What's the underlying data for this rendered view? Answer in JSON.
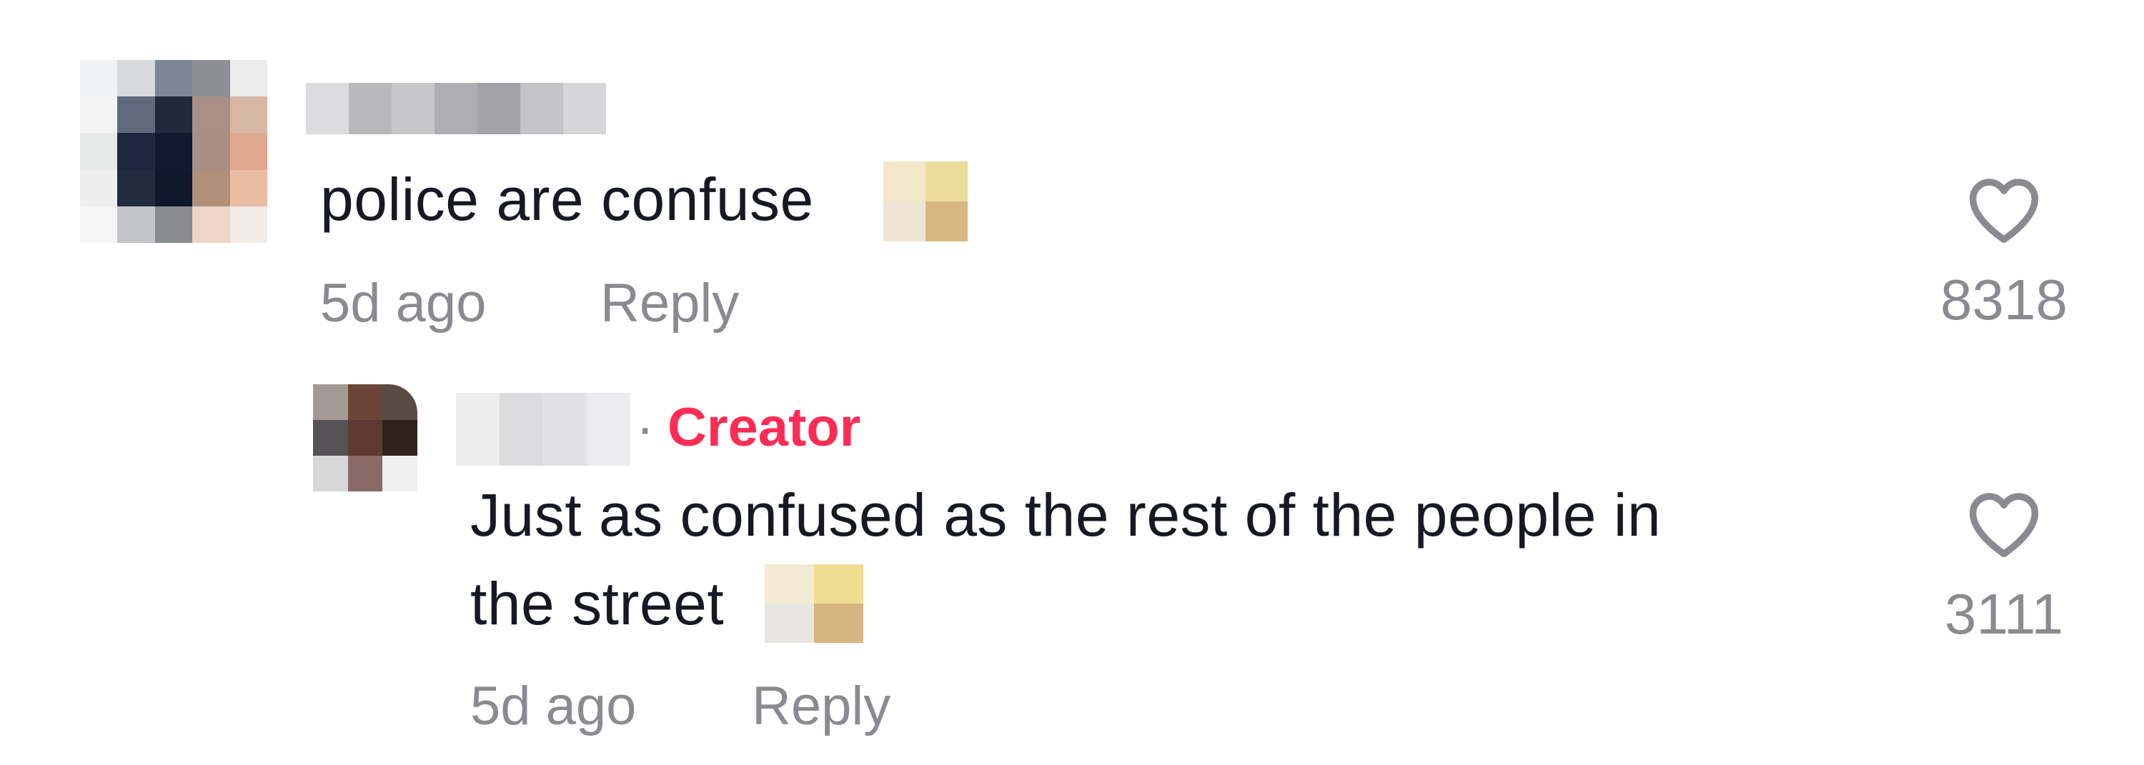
{
  "comments": [
    {
      "text": "police are confuse",
      "time": "5d ago",
      "reply_label": "Reply",
      "likes": "8318"
    }
  ],
  "reply": {
    "creator_separator": "·",
    "creator_label": "Creator",
    "text_line1": "Just as confused as the rest of the people in",
    "text_line2": "the street",
    "time": "5d ago",
    "reply_label": "Reply",
    "likes": "3111"
  },
  "colors": {
    "creator_accent": "#fe2c55",
    "meta_gray": "#8a8b91",
    "text_dark": "#161823"
  },
  "icons": {
    "like": "heart-outline-icon"
  }
}
